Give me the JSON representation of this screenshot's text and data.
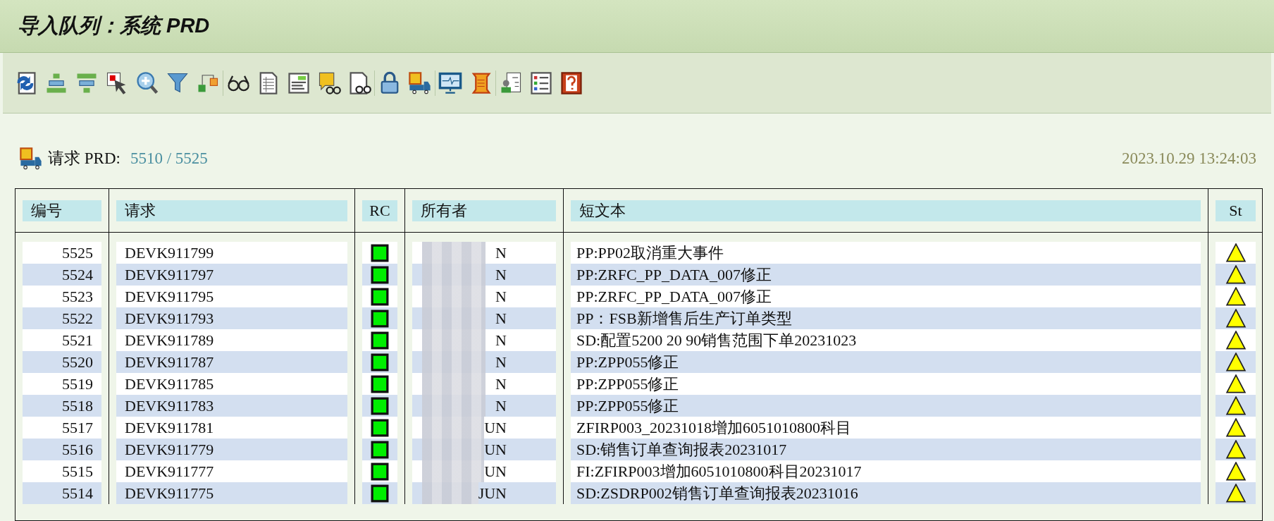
{
  "window": {
    "title": "导入队列：系统 PRD"
  },
  "request_line": {
    "label": "请求 PRD:",
    "current": "5510",
    "separator": "/",
    "total": "5525",
    "datetime": "2023.10.29 13:24:03"
  },
  "table": {
    "columns": [
      "编号",
      "请求",
      "RC",
      "所有者",
      "短文本",
      "St"
    ],
    "rows": [
      {
        "number": "5525",
        "request": "DEVK911799",
        "rc_ok": true,
        "owner": "N",
        "text": "PP:PP02取消重大事件",
        "warning": true
      },
      {
        "number": "5524",
        "request": "DEVK911797",
        "rc_ok": true,
        "owner": "N",
        "text": "PP:ZRFC_PP_DATA_007修正",
        "warning": true
      },
      {
        "number": "5523",
        "request": "DEVK911795",
        "rc_ok": true,
        "owner": "N",
        "text": "PP:ZRFC_PP_DATA_007修正",
        "warning": true
      },
      {
        "number": "5522",
        "request": "DEVK911793",
        "rc_ok": true,
        "owner": "N",
        "text": "PP：FSB新增售后生产订单类型",
        "warning": true
      },
      {
        "number": "5521",
        "request": "DEVK911789",
        "rc_ok": true,
        "owner": "N",
        "text": "SD:配置5200 20 90销售范围下单20231023",
        "warning": true
      },
      {
        "number": "5520",
        "request": "DEVK911787",
        "rc_ok": true,
        "owner": "N",
        "text": "PP:ZPP055修正",
        "warning": true
      },
      {
        "number": "5519",
        "request": "DEVK911785",
        "rc_ok": true,
        "owner": "N",
        "text": "PP:ZPP055修正",
        "warning": true
      },
      {
        "number": "5518",
        "request": "DEVK911783",
        "rc_ok": true,
        "owner": "N",
        "text": "PP:ZPP055修正",
        "warning": true
      },
      {
        "number": "5517",
        "request": "DEVK911781",
        "rc_ok": true,
        "owner": "UN",
        "text": "ZFIRP003_20231018增加6051010800科目",
        "warning": true
      },
      {
        "number": "5516",
        "request": "DEVK911779",
        "rc_ok": true,
        "owner": "UN",
        "text": "SD:销售订单查询报表20231017",
        "warning": true
      },
      {
        "number": "5515",
        "request": "DEVK911777",
        "rc_ok": true,
        "owner": "UN",
        "text": "FI:ZFIRP003增加6051010800科目20231017",
        "warning": true
      },
      {
        "number": "5514",
        "request": "DEVK911775",
        "rc_ok": true,
        "owner": "JUN",
        "text": "SD:ZSDRP002销售订单查询报表20231016",
        "warning": true
      }
    ]
  }
}
